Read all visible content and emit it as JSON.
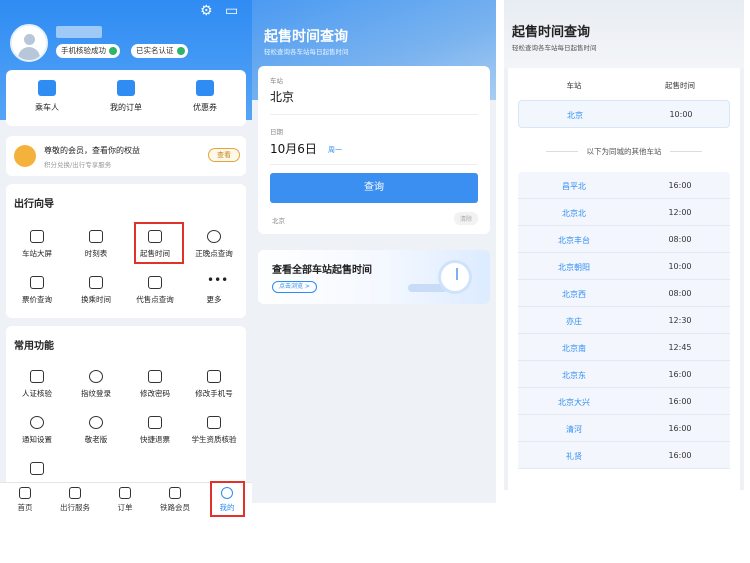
{
  "panel1": {
    "badges": [
      "手机核验成功",
      "已实名认证"
    ],
    "quick": [
      "乘车人",
      "我的订单",
      "优惠券"
    ],
    "member": {
      "title": "尊敬的会员，查看你的权益",
      "subtitle": "积分兑换/出行专享服务",
      "button": "查看"
    },
    "guide": {
      "title": "出行向导",
      "items": [
        "车站大屏",
        "时刻表",
        "起售时间",
        "正晚点查询",
        "票价查询",
        "换乘时间",
        "代售点查询",
        "更多"
      ]
    },
    "common": {
      "title": "常用功能",
      "items": [
        "人证核验",
        "指纹登录",
        "修改密码",
        "修改手机号",
        "通知设置",
        "敬老版",
        "快捷退票",
        "学生资质核验"
      ]
    },
    "tabs": [
      "首页",
      "出行服务",
      "订单",
      "铁路会员",
      "我的"
    ]
  },
  "panel2": {
    "title": "起售时间查询",
    "subtitle": "轻松查询各车站每日起售时间",
    "station_label": "车站",
    "station_value": "北京",
    "date_label": "日期",
    "date_value": "10月6日",
    "weekday": "周一",
    "query_button": "查询",
    "history": "北京",
    "clear": "清除",
    "banner_title": "查看全部车站起售时间",
    "banner_button": "点击浏览 >"
  },
  "panel3": {
    "title": "起售时间查询",
    "subtitle": "轻松查询各车站每日起售时间",
    "col_station": "车站",
    "col_time": "起售时间",
    "primary": {
      "station": "北京",
      "time": "10:00"
    },
    "divider": "以下为同城的其他车站",
    "rows": [
      {
        "station": "昌平北",
        "time": "16:00"
      },
      {
        "station": "北京北",
        "time": "12:00"
      },
      {
        "station": "北京丰台",
        "time": "08:00"
      },
      {
        "station": "北京朝阳",
        "time": "10:00"
      },
      {
        "station": "北京西",
        "time": "08:00"
      },
      {
        "station": "亦庄",
        "time": "12:30"
      },
      {
        "station": "北京南",
        "time": "12:45"
      },
      {
        "station": "北京东",
        "time": "16:00"
      },
      {
        "station": "北京大兴",
        "time": "16:00"
      },
      {
        "station": "清河",
        "time": "16:00"
      },
      {
        "station": "礼贤",
        "time": "16:00"
      }
    ]
  }
}
